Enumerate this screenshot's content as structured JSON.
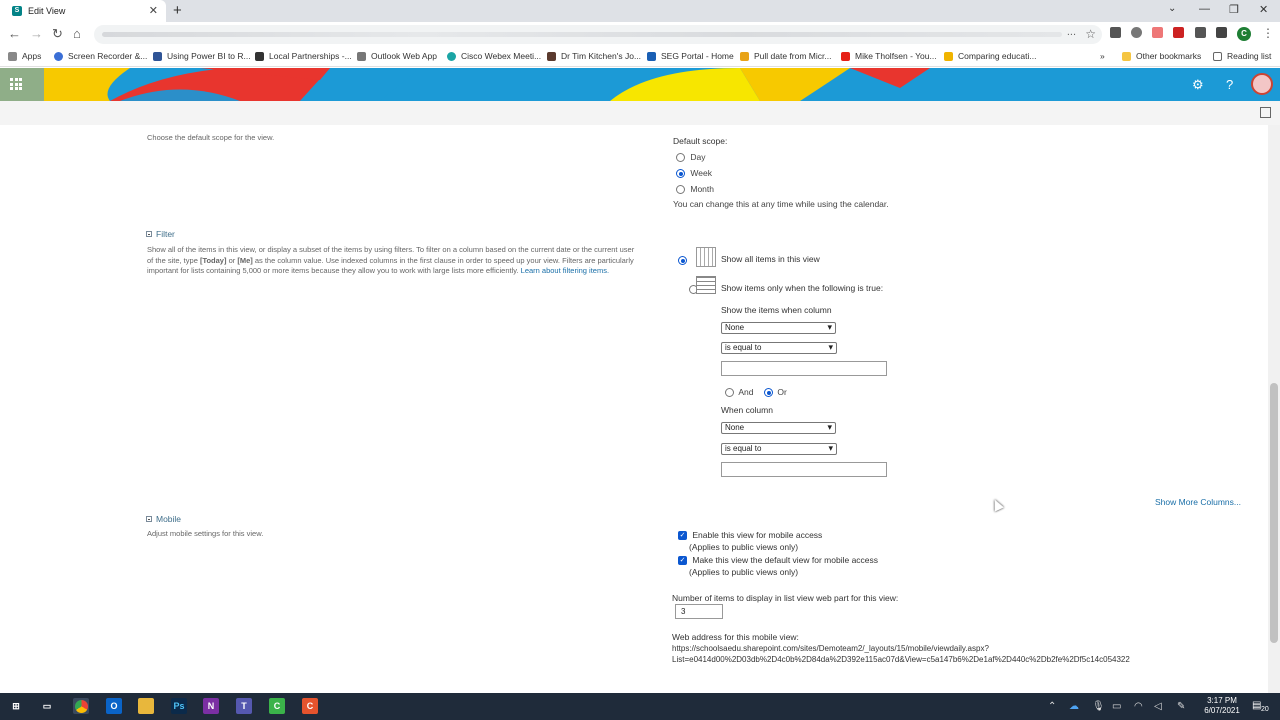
{
  "browser": {
    "tab_title": "Edit View",
    "bookmarks": [
      {
        "label": "Apps",
        "color": "#888888"
      },
      {
        "label": "Screen Recorder &...",
        "color": "#3b6fd6"
      },
      {
        "label": "Using Power BI to R...",
        "color": "#2f5496"
      },
      {
        "label": "Local Partnerships -...",
        "color": "#333333"
      },
      {
        "label": "Outlook Web App",
        "color": "#777777"
      },
      {
        "label": "Cisco Webex Meeti...",
        "color": "#1ba5a5"
      },
      {
        "label": "Dr Tim Kitchen's Jo...",
        "color": "#5b3a2e"
      },
      {
        "label": "SEG Portal - Home",
        "color": "#1a5fb4"
      },
      {
        "label": "Pull date from Micr...",
        "color": "#e8a317"
      },
      {
        "label": "Mike Tholfsen - You...",
        "color": "#e62117"
      },
      {
        "label": "Comparing educati...",
        "color": "#f0b400"
      }
    ],
    "other_bookmarks": "Other bookmarks",
    "reading_list": "Reading list",
    "profile_initial": "C"
  },
  "calendar_scope": {
    "description": "Choose the default scope for the view.",
    "label": "Default scope:",
    "options": [
      "Day",
      "Week",
      "Month"
    ],
    "selected": "Week",
    "note": "You can change this at any time while using the calendar."
  },
  "filter": {
    "title": "Filter",
    "description": "Show all of the items in this view, or display a subset of the items by using filters. To filter on a column based on the current date or the current user of the site, type [Today] or [Me] as the column value. Use indexed columns in the first clause in order to speed up your view. Filters are particularly important for lists containing 5,000 or more items because they allow you to work with large lists more efficiently.",
    "desc_line1": "Show all of the items in this view, or display a subset of the items by using filters. To filter on a column based on the current date or the current user",
    "desc_line2_a": "of the site, type ",
    "desc_today": "[Today]",
    "desc_or": " or ",
    "desc_me": "[Me]",
    "desc_line2_b": " as the column value. Use indexed columns in the first clause in order to speed up your view. Filters are particularly",
    "desc_line3": "important for lists containing 5,000 or more items because they allow you to work with large lists more efficiently.",
    "learn_link": "Learn about filtering items.",
    "option_all": "Show all items in this view",
    "option_when": "Show items only when the following is true:",
    "show_when_label": "Show the items when column",
    "column1": "None",
    "operator1": "is equal to",
    "value1": "",
    "and_label": "And",
    "or_label": "Or",
    "when_column_label": "When column",
    "column2": "None",
    "operator2": "is equal to",
    "value2": "",
    "more_columns": "Show More Columns..."
  },
  "mobile": {
    "title": "Mobile",
    "description": "Adjust mobile settings for this view.",
    "enable_label": "Enable this view for mobile access",
    "enable_note": "(Applies to public views only)",
    "default_label": "Make this view the default view for mobile access",
    "default_note": "(Applies to public views only)",
    "items_label": "Number of items to display in list view web part for this view:",
    "items_value": "3",
    "address_label": "Web address for this mobile view:",
    "address_line1": "https://schoolsaedu.sharepoint.com/sites/Demoteam2/_layouts/15/mobile/viewdaily.aspx?",
    "address_line2": "List=e0414d00%2D03db%2D4c0b%2D84da%2D392e115ac07d&View=c5a147b6%2De1af%2D440c%2Db2fe%2Df5c14c054322"
  },
  "taskbar": {
    "time": "3:17 PM",
    "date": "6/07/2021",
    "notifications": "20"
  }
}
